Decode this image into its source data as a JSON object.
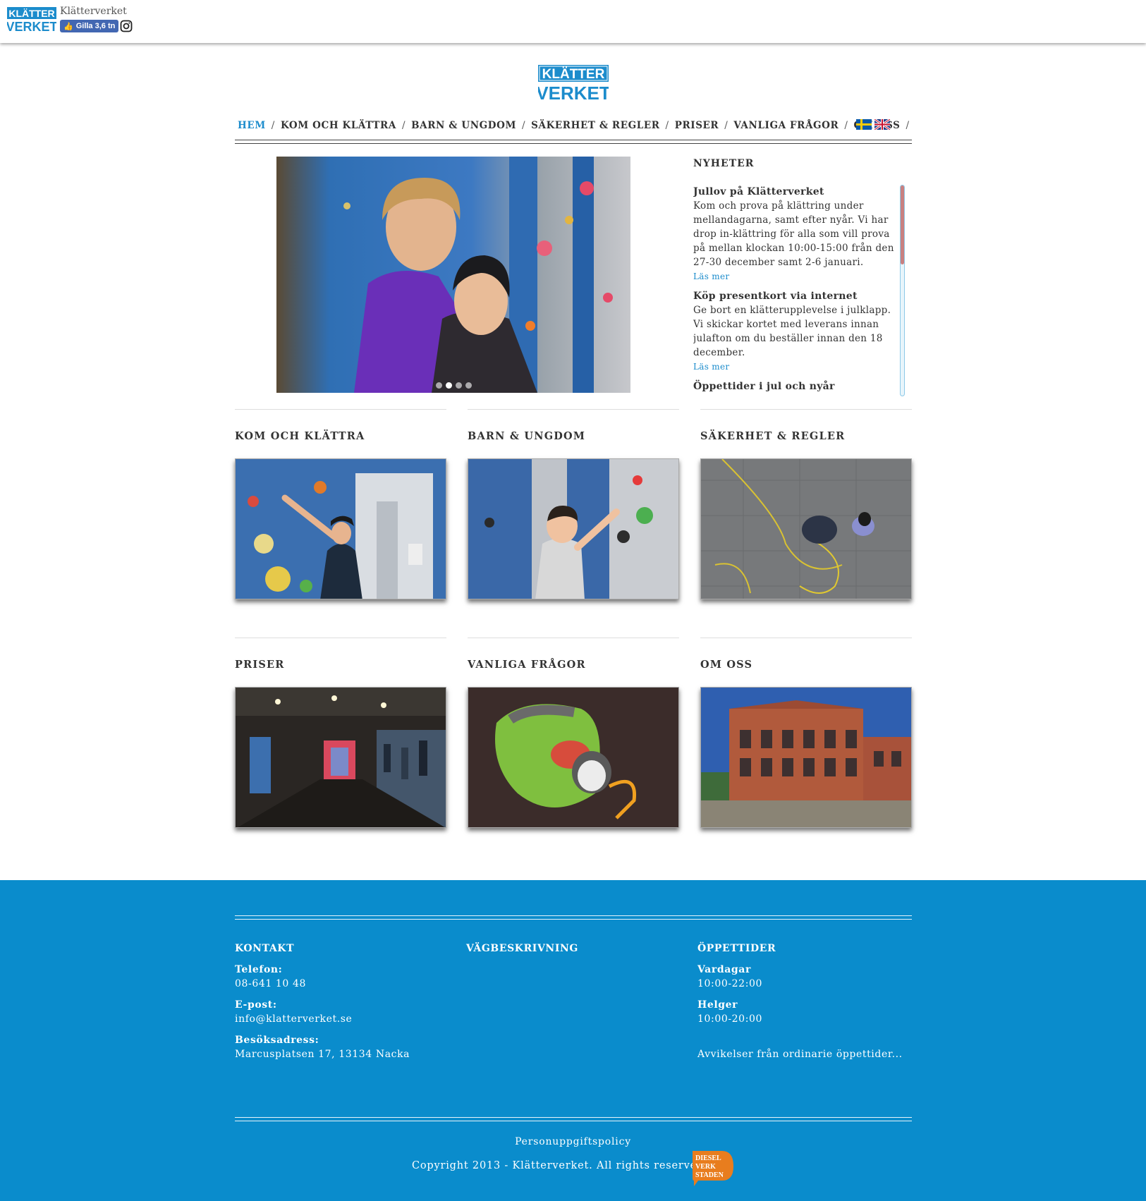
{
  "topbar": {
    "logo_line1": "KLÄTTER",
    "logo_line2": "VERKET",
    "title": "Klätterverket",
    "like_label": "Gilla 3,6 tn",
    "instagram_icon": "instagram-icon"
  },
  "logo": {
    "line1": "KLÄTTER",
    "line2": "VERKET"
  },
  "nav": {
    "items": [
      "HEM",
      "KOM OCH KLÄTTRA",
      "BARN & UNGDOM",
      "SÄKERHET & REGLER",
      "PRISER",
      "VANLIGA FRÅGOR",
      "OM OSS"
    ],
    "separator": "/",
    "languages": [
      "sv-flag-icon",
      "uk-flag-icon"
    ]
  },
  "slider": {
    "slides": 4,
    "active_slide": 2
  },
  "news": {
    "heading": "NYHETER",
    "items": [
      {
        "title": "Jullov på Klätterverket",
        "body": "Kom och prova på klättring under mellandagarna, samt efter nyår. Vi har drop in-klättring för alla som vill prova på mellan klockan 10:00-15:00 från den 27-30 december samt 2-6 januari.",
        "more": "Läs mer"
      },
      {
        "title": "Köp presentkort via internet",
        "body": "Ge bort en klätterupplevelse i julklapp. Vi skickar kortet med leverans innan julafton om du beställer innan den 18 december.",
        "more": "Läs mer"
      },
      {
        "title": "Öppettider i jul och nyår",
        "body": "",
        "more": ""
      }
    ]
  },
  "sections": [
    {
      "title": "KOM OCH KLÄTTRA"
    },
    {
      "title": "BARN & UNGDOM"
    },
    {
      "title": "SÄKERHET & REGLER"
    },
    {
      "title": "PRISER"
    },
    {
      "title": "VANLIGA FRÅGOR"
    },
    {
      "title": "OM OSS"
    }
  ],
  "footer": {
    "kontakt": {
      "heading": "KONTAKT",
      "phone_label": "Telefon:",
      "phone": "08-641 10 48",
      "email_label": "E-post:",
      "email": "info@klatterverket.se",
      "address_label": "Besöksadress:",
      "address": "Marcusplatsen 17, 13134 Nacka"
    },
    "directions": {
      "heading": "VÄGBESKRIVNING"
    },
    "hours": {
      "heading": "ÖPPETTIDER",
      "weekday_label": "Vardagar",
      "weekday": "10:00-22:00",
      "weekend_label": "Helger",
      "weekend": "10:00-20:00",
      "deviations": "Avvikelser från ordinarie öppettider..."
    },
    "policy": "Personuppgiftspolicy",
    "copyright": "Copyright 2013 - Klätterverket. All rights reserved",
    "badge": {
      "line1": "DIESEL",
      "line2": "VERK",
      "line3": "STADEN"
    }
  },
  "colors": {
    "brand_blue": "#0a8ccc",
    "nav_active": "#1c8ccc",
    "badge_orange": "#e87d1e"
  }
}
